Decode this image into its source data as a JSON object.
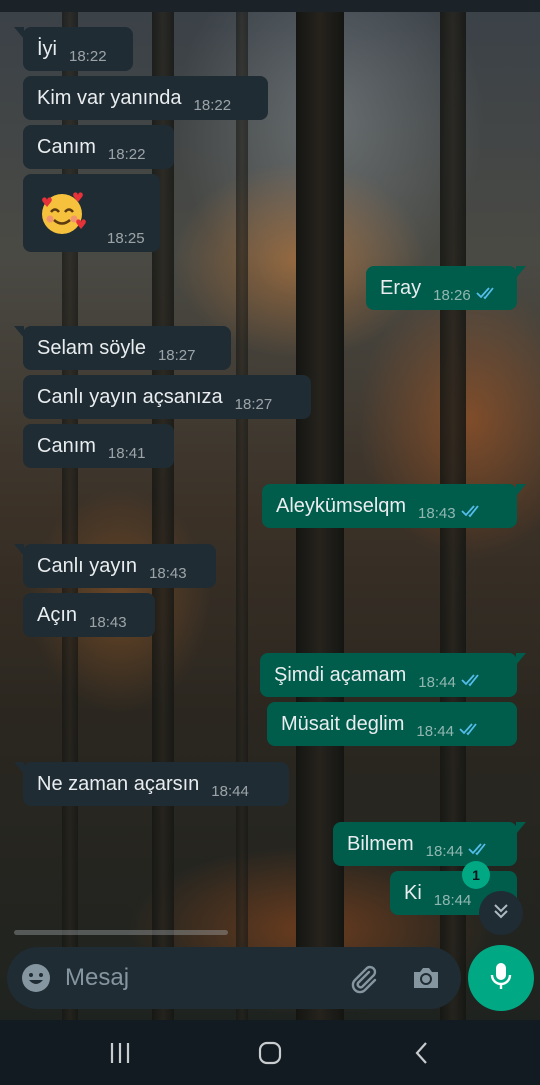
{
  "wallpaper": {
    "description_colors": [
      "#3a4148",
      "#3b3127",
      "#1f231f"
    ]
  },
  "colors": {
    "incoming_bubble": "#1f2c34",
    "outgoing_bubble": "#005c4b",
    "accent": "#00a884",
    "read_ticks": "#53bdeb"
  },
  "messages": [
    {
      "direction": "incoming",
      "text": "İyi",
      "time": "18:22"
    },
    {
      "direction": "incoming",
      "text": "Kim var yanında",
      "time": "18:22"
    },
    {
      "direction": "incoming",
      "text": "Canım",
      "time": "18:22"
    },
    {
      "direction": "incoming",
      "emoji": "smiling-face-with-hearts",
      "time": "18:25"
    },
    {
      "direction": "outgoing",
      "text": "Eray",
      "time": "18:26",
      "status": "read"
    },
    {
      "direction": "incoming",
      "text": "Selam söyle",
      "time": "18:27"
    },
    {
      "direction": "incoming",
      "text": "Canlı yayın açsanıza",
      "time": "18:27"
    },
    {
      "direction": "incoming",
      "text": "Canım",
      "time": "18:41"
    },
    {
      "direction": "outgoing",
      "text": "Aleykümselqm",
      "time": "18:43",
      "status": "read"
    },
    {
      "direction": "incoming",
      "text": "Canlı yayın",
      "time": "18:43"
    },
    {
      "direction": "incoming",
      "text": "Açın",
      "time": "18:43"
    },
    {
      "direction": "outgoing",
      "text": "Şimdi açamam",
      "time": "18:44",
      "status": "read"
    },
    {
      "direction": "outgoing",
      "text": "Müsait deglim",
      "time": "18:44",
      "status": "read"
    },
    {
      "direction": "incoming",
      "text": "Ne zaman açarsın",
      "time": "18:44"
    },
    {
      "direction": "outgoing",
      "text": "Bilmem",
      "time": "18:44",
      "status": "read"
    },
    {
      "direction": "outgoing",
      "text": "Ki",
      "time": "18:44",
      "status": "read"
    }
  ],
  "unread_badge": "1",
  "scroll_down_icon": "double-chevron-down-icon",
  "input": {
    "placeholder": "Mesaj",
    "emoji_icon": "emoji-icon",
    "attach_icon": "paperclip-icon",
    "camera_icon": "camera-icon"
  },
  "mic_icon": "microphone-icon",
  "navbar": {
    "recent_icon": "recent-apps-icon",
    "home_icon": "home-icon",
    "back_icon": "back-icon"
  }
}
